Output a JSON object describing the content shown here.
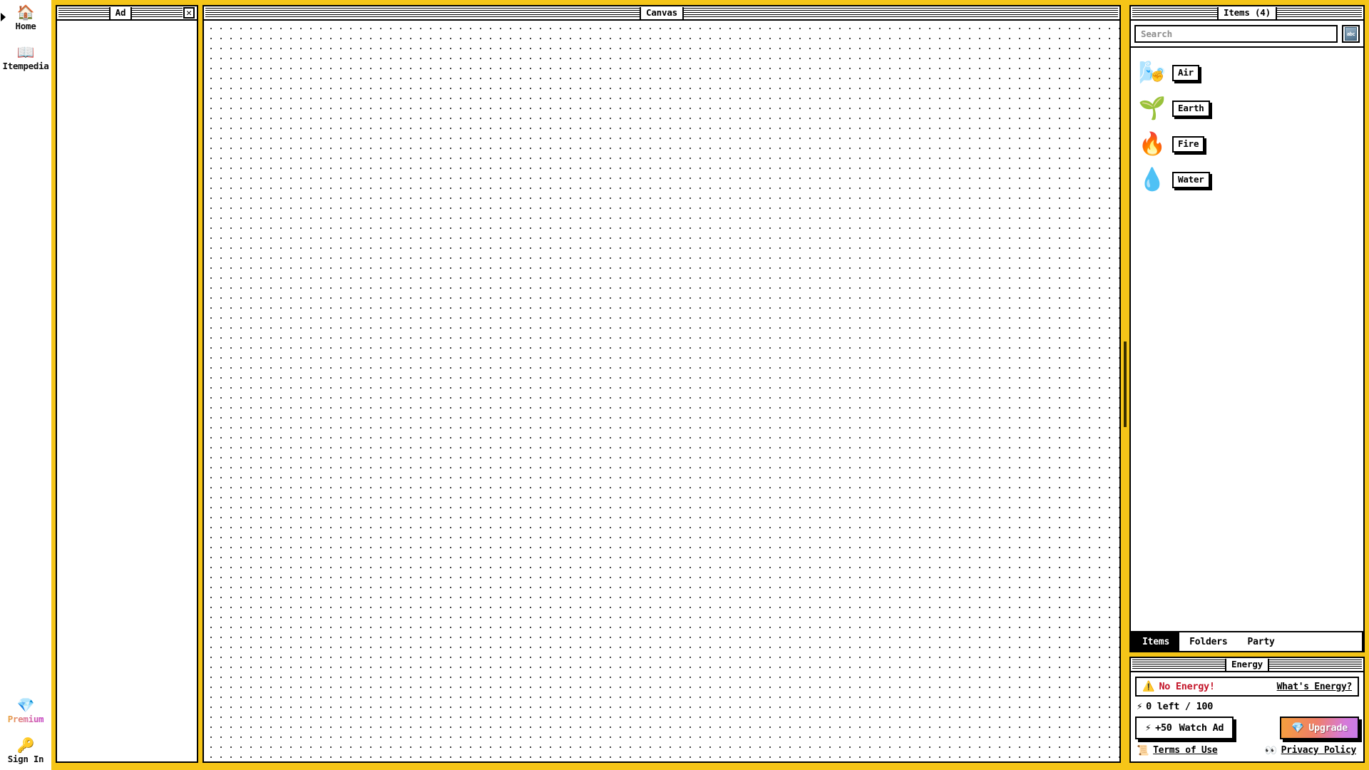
{
  "theme": {
    "frame_color": "#f5c518",
    "accent_red": "#c4162a",
    "upgrade_gradient_start": "#f59f3c",
    "upgrade_gradient_end": "#c77be8",
    "premium_gradient_start": "#e8a23c",
    "premium_gradient_end": "#c23fc2"
  },
  "left_rail": {
    "collapse_arrow_icon": "▶",
    "items": [
      {
        "label": "Home",
        "icon": "🏠",
        "icon_name": "house-icon"
      },
      {
        "label": "Itempedia",
        "icon": "📖",
        "icon_name": "open-book-icon"
      }
    ],
    "bottom_items": [
      {
        "label": "Premium",
        "icon": "💎",
        "icon_name": "diamond-icon"
      },
      {
        "label": "Sign In",
        "icon": "🔑",
        "icon_name": "key-icon"
      }
    ]
  },
  "ad_window": {
    "title": "Ad",
    "close_label": "✕"
  },
  "canvas_window": {
    "title": "Canvas"
  },
  "items_window": {
    "title": "Items (4)",
    "search": {
      "placeholder": "Search",
      "value": ""
    },
    "ime_button": {
      "glyph": "abc",
      "icon_name": "abc-keyboard-icon"
    },
    "items": [
      {
        "name": "Air",
        "emoji": "🌬️",
        "icon_name": "wind-cloud-icon",
        "cursor_overlay": "✊"
      },
      {
        "name": "Earth",
        "emoji": "🌱",
        "icon_name": "seedling-icon",
        "cursor_overlay": ""
      },
      {
        "name": "Fire",
        "emoji": "🔥",
        "icon_name": "flame-icon",
        "cursor_overlay": ""
      },
      {
        "name": "Water",
        "emoji": "💧",
        "icon_name": "droplet-icon",
        "cursor_overlay": ""
      }
    ]
  },
  "tabs": [
    {
      "label": "Items",
      "active": true
    },
    {
      "label": "Folders",
      "active": false
    },
    {
      "label": "Party",
      "active": false
    }
  ],
  "energy_window": {
    "title": "Energy",
    "warning_icon": "⚠️",
    "warning_text": "No Energy!",
    "whats_energy_label": "What's Energy?",
    "bolt_icon": "⚡",
    "count_text": "0 left / 100",
    "watch_ad": {
      "bolt_icon": "⚡",
      "amount": "+50",
      "label": "Watch Ad"
    },
    "upgrade": {
      "icon": "💎",
      "label": "Upgrade"
    },
    "legal": [
      {
        "label": "Terms of Use",
        "icon": "📜",
        "icon_name": "scroll-icon"
      },
      {
        "label": "Privacy Policy",
        "icon": "👀",
        "icon_name": "eyes-icon"
      }
    ]
  }
}
